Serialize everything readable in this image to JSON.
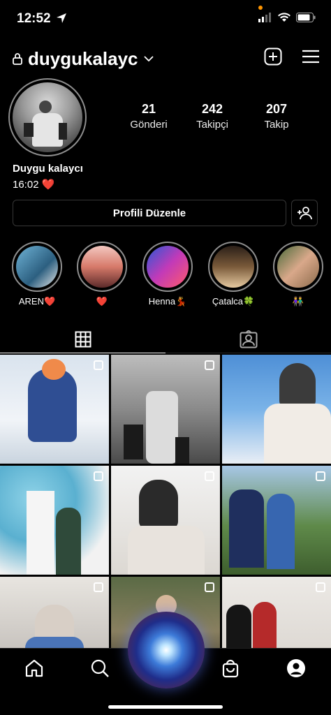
{
  "status_bar": {
    "time": "12:52"
  },
  "profile": {
    "username": "duygukalayc",
    "stats": [
      {
        "value": "21",
        "label": "Gönderi"
      },
      {
        "value": "242",
        "label": "Takipçi"
      },
      {
        "value": "207",
        "label": "Takip"
      }
    ],
    "display_name": "Duygu kalaycı",
    "bio": "16:02 ❤️",
    "edit_button_label": "Profili Düzenle"
  },
  "highlights": [
    {
      "label": "AREN❤️",
      "color": "#4a90b8"
    },
    {
      "label": "❤️",
      "color": "#b8574a"
    },
    {
      "label": "Henna💃",
      "color": "#8a3fa0"
    },
    {
      "label": "Çatalca🍀",
      "color": "#7a5a3a"
    },
    {
      "label": "👫",
      "color": "#9a7a5a"
    }
  ],
  "tabs": [
    {
      "name": "posts-grid",
      "active": true
    },
    {
      "name": "tagged",
      "active": false
    }
  ],
  "posts": [
    {
      "desc": "baby in blue snowsuit on snow",
      "color": "#c9d6e6",
      "selectable": true
    },
    {
      "desc": "black and white couple at sea",
      "color": "#7d7d7d",
      "selectable": true
    },
    {
      "desc": "woman in hijab by the sea",
      "color": "#5a8fc4",
      "selectable": false
    },
    {
      "desc": "family with balloons",
      "color": "#6fb1c9",
      "selectable": true
    },
    {
      "desc": "couple with newborn",
      "color": "#e6e2de",
      "selectable": true
    },
    {
      "desc": "family in garden",
      "color": "#5f8a4a",
      "selectable": true
    },
    {
      "desc": "woman with baby",
      "color": "#b8b3ae",
      "selectable": true
    },
    {
      "desc": "group at restaurant",
      "color": "#6a6a55",
      "selectable": true
    },
    {
      "desc": "couple in front of wall",
      "color": "#d8d3ce",
      "selectable": true
    }
  ],
  "nav": [
    {
      "name": "home"
    },
    {
      "name": "search"
    },
    {
      "name": "reels"
    },
    {
      "name": "shop"
    },
    {
      "name": "profile"
    }
  ]
}
